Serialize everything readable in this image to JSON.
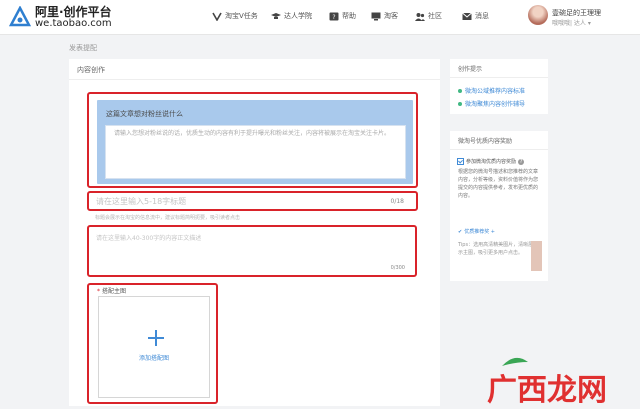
{
  "header": {
    "logo_title": "阿里·创作平台",
    "logo_subtitle": "we.taobao.com",
    "nav": [
      {
        "label": "淘宝V任务",
        "icon": "v-icon"
      },
      {
        "label": "达人学院",
        "icon": "graduation-cap-icon"
      },
      {
        "label": "帮助",
        "icon": "help-icon"
      },
      {
        "label": "淘客",
        "icon": "monitor-icon"
      },
      {
        "label": "社区",
        "icon": "users-icon"
      },
      {
        "label": "消息",
        "icon": "mail-icon"
      }
    ],
    "user_name": "壹碗足的王理理",
    "user_role": "哦哦哦| 达人"
  },
  "breadcrumb": "发表提配",
  "main": {
    "card_title": "内容创作",
    "question_title": "这篇文章想对粉丝说什么",
    "question_placeholder": "请输入您想对粉丝说的话，优质生动的内容有利于提升曝光和粉丝关注，内容将被展示在淘宝关注卡片。",
    "title_placeholder": "请在这里输入5-18字标题",
    "title_count": "0/18",
    "title_hint": "标题会展示在淘宝的信息流中，建议标题简明扼要，吸引读者点击",
    "desc_placeholder": "请在这里输入40-300字的内容正文描述",
    "desc_count": "0/300",
    "cover_label": "搭配主图",
    "cover_required": "*",
    "cover_upload": "添加搭配图"
  },
  "sidebar": {
    "tips_title": "创作提示",
    "tips_links": [
      "微淘公域推荐内容标准",
      "微淘聚焦内容创作辅导"
    ],
    "activity_title": "微淘号优质内容奖励",
    "activity_check": "参加微淘优质内容奖励",
    "activity_body": "根据您的微淘号描述和您推荐的文章内容，分析等级，资料价值将作为您提交的内容提供参考，发布更优质的内容。",
    "activity_link": "优质推荐奖 +",
    "activity_footer": "Tips：选用高清精美图片，清晰展示主图，吸引更多用户点击。"
  },
  "watermark": "广西龙网",
  "colors": {
    "accent": "#3f8ad6",
    "highlight_box": "#d9232a",
    "question_panel": "#a9c9ec"
  }
}
